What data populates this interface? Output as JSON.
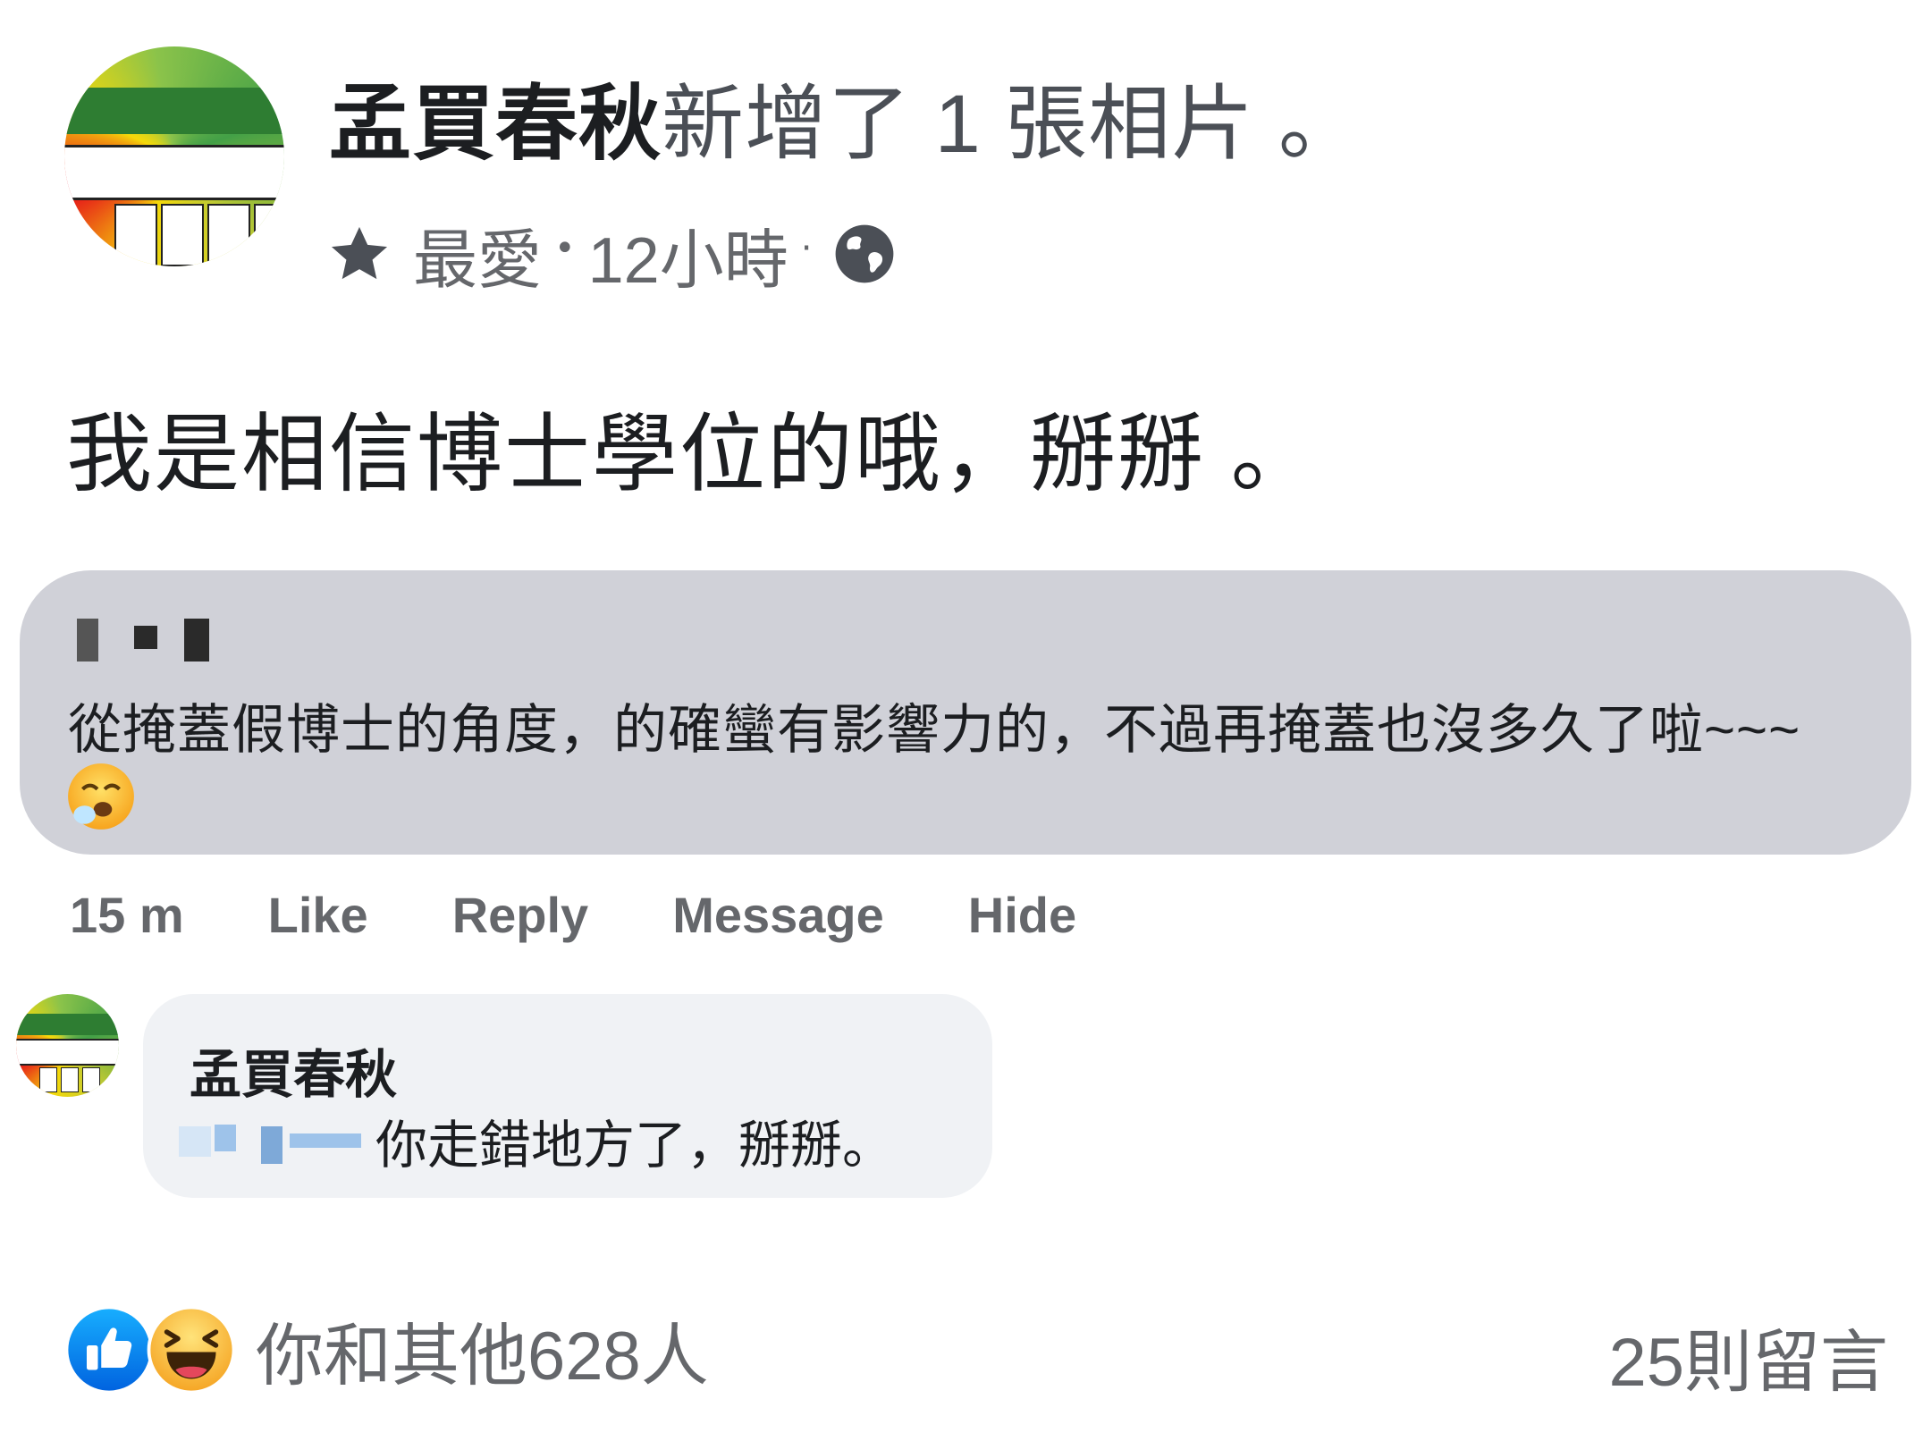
{
  "post": {
    "author": "孟買春秋",
    "action": "新增了 1 張相片 。",
    "meta": {
      "audience_label": "最愛",
      "time": "12小時",
      "star_icon": "star-icon",
      "globe_icon": "globe-icon"
    },
    "text": "我是相信博士學位的哦，掰掰 。"
  },
  "comments": [
    {
      "author_redacted": true,
      "text": "從掩蓋假博士的角度，的確蠻有影響力的，不過再掩蓋也沒多久了啦~~~",
      "emoji": "sleepy-face",
      "actions": {
        "time": "15 m",
        "like": "Like",
        "reply": "Reply",
        "message": "Message",
        "hide": "Hide"
      }
    },
    {
      "author": "孟買春秋",
      "mention_redacted": true,
      "text": "你走錯地方了，掰掰。"
    }
  ],
  "footer": {
    "reactions": [
      "like",
      "haha"
    ],
    "reactions_text": "你和其他628人",
    "comments_count": "25則留言"
  },
  "colors": {
    "bubble_primary": "#d0d1d8",
    "bubble_reply": "#f0f2f5",
    "secondary_text": "#65676b",
    "like_blue": "#1877f2"
  }
}
